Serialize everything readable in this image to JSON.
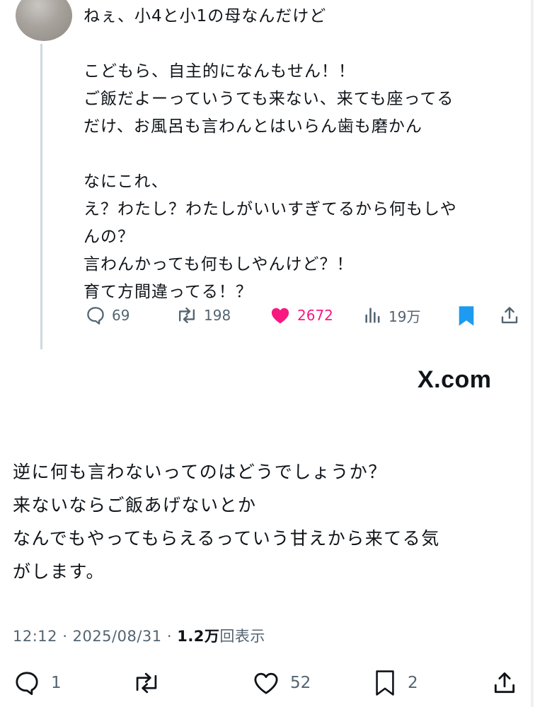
{
  "quoted_post": {
    "lines": [
      "ねぇ、小4と小1の母なんだけど",
      "",
      "こどもら、自主的になんもせん！！",
      "ご飯だよーっていうても来ない、来ても座ってる",
      "だけ、お風呂も言わんとはいらん歯も磨かん",
      "",
      "なにこれ、",
      "え？わたし？わたしがいいすぎてるから何もしや",
      "んの？",
      "言わんかっても何もしやんけど？！",
      "育て方間違ってる！？"
    ],
    "actions": {
      "replies": "69",
      "reposts": "198",
      "likes": "2672",
      "views": "19万"
    },
    "colors": {
      "like": "#f91880",
      "bookmark": "#1d9bf0",
      "muted": "#536471"
    }
  },
  "embed_source": "X.com",
  "reply_post": {
    "lines": [
      "逆に何も言わないってのはどうでしょうか？",
      "来ないならご飯あげないとか",
      "なんでもやってもらえるっていう甘えから来てる気",
      "がします。"
    ],
    "meta": {
      "time": "12:12",
      "separator": "·",
      "date": "2025/08/31",
      "views_count": "1.2万",
      "views_label": "回表示"
    },
    "actions": {
      "replies": "1",
      "likes": "52",
      "bookmarks": "2"
    }
  }
}
